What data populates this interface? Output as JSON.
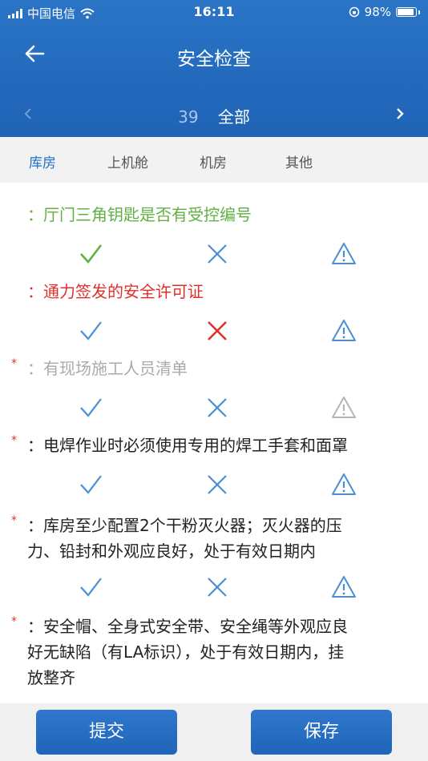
{
  "status_bar": {
    "carrier": "中国电信",
    "time": "16:11",
    "battery": "98%"
  },
  "header": {
    "title": "安全检查"
  },
  "nav": {
    "count": "39",
    "scope": "全部"
  },
  "tabs": [
    {
      "label": "库房",
      "active": true
    },
    {
      "label": "上机舱",
      "active": false
    },
    {
      "label": "机房",
      "active": false
    },
    {
      "label": "其他",
      "active": false
    }
  ],
  "items": [
    {
      "text": "：厅门三角钥匙是否有受控编号",
      "required": false,
      "state": "pass"
    },
    {
      "text": "：通力签发的安全许可证",
      "required": false,
      "state": "fail"
    },
    {
      "text": "：有现场施工人员清单",
      "required": true,
      "state": "disabled"
    },
    {
      "text": "：电焊作业时必须使用专用的焊工手套和面罩",
      "required": true,
      "state": "none"
    },
    {
      "text_lines": [
        "：库房至少配置2个干粉灭火器；灭火器的压",
        "力、铅封和外观应良好，处于有效日期内"
      ],
      "required": true,
      "state": "none"
    },
    {
      "text_lines": [
        "：安全帽、全身式安全带、安全绳等外观应良",
        "好无缺陷（有LA标识），处于有效日期内，挂",
        "放整齐"
      ],
      "required": true,
      "state": "none"
    }
  ],
  "required_mark": "*",
  "colors": {
    "primary": "#1f65ba",
    "pass": "#61b044",
    "fail": "#e0302c",
    "option": "#4a8fd4",
    "disabled": "#b5b5b5"
  },
  "footer": {
    "submit_label": "提交",
    "save_label": "保存"
  }
}
